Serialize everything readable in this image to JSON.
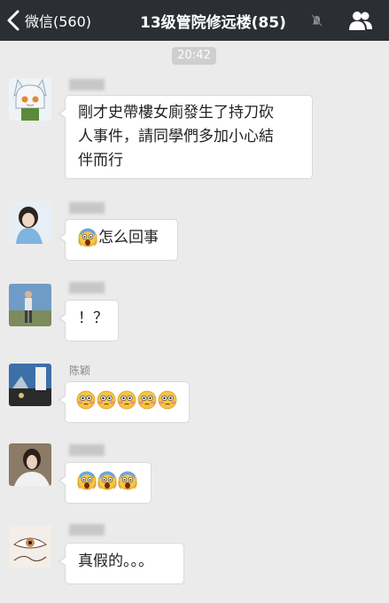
{
  "header": {
    "back_label": "微信(560)",
    "title": "13级管院修远楼(85)"
  },
  "timestamp": "20:42",
  "messages": [
    {
      "sender": "",
      "line1": "剛才史帶樓女廁發生了持刀砍",
      "line2": "人事件，請同學們多加小心結",
      "line3": "伴而行"
    },
    {
      "sender": "",
      "text": "怎么回事",
      "emojis": [
        "scream-emoji"
      ]
    },
    {
      "sender": "",
      "text": "！？"
    },
    {
      "sender": "陈颖",
      "emojis": [
        "flushed-emoji",
        "flushed-emoji",
        "flushed-emoji",
        "flushed-emoji",
        "flushed-emoji"
      ]
    },
    {
      "sender": "",
      "emojis": [
        "scream-emoji",
        "scream-emoji",
        "scream-emoji"
      ]
    },
    {
      "sender": "",
      "text": "真假的。。。"
    }
  ],
  "icons": {
    "back": "chevron-left-icon",
    "mute": "mute-bell-icon",
    "group": "group-members-icon"
  }
}
